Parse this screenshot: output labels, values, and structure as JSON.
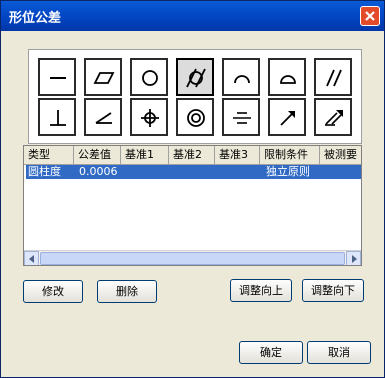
{
  "window": {
    "title": "形位公差"
  },
  "symbols": [
    {
      "name": "straightness-icon",
      "sel": false
    },
    {
      "name": "flatness-icon",
      "sel": false
    },
    {
      "name": "circularity-icon",
      "sel": false
    },
    {
      "name": "cylindricity-icon",
      "sel": true
    },
    {
      "name": "line-profile-icon",
      "sel": false
    },
    {
      "name": "surface-profile-icon",
      "sel": false
    },
    {
      "name": "parallelism-icon",
      "sel": false
    },
    {
      "name": "perpendicularity-icon",
      "sel": false
    },
    {
      "name": "angularity-icon",
      "sel": false
    },
    {
      "name": "position-icon",
      "sel": false
    },
    {
      "name": "concentricity-icon",
      "sel": false
    },
    {
      "name": "symmetry-icon",
      "sel": false
    },
    {
      "name": "circular-runout-icon",
      "sel": false
    },
    {
      "name": "total-runout-icon",
      "sel": false
    }
  ],
  "table": {
    "columns": [
      "类型",
      "公差值",
      "基准1",
      "基准2",
      "基准3",
      "限制条件",
      "被测要"
    ],
    "rows": [
      {
        "type": "圆柱度",
        "value": "0.0006",
        "datum1": "",
        "datum2": "",
        "datum3": "",
        "condition": "独立原则",
        "measured": ""
      }
    ]
  },
  "buttons": {
    "modify": "修改",
    "delete": "删除",
    "move_up": "调整向上",
    "move_down": "调整向下",
    "ok": "确定",
    "cancel": "取消"
  }
}
